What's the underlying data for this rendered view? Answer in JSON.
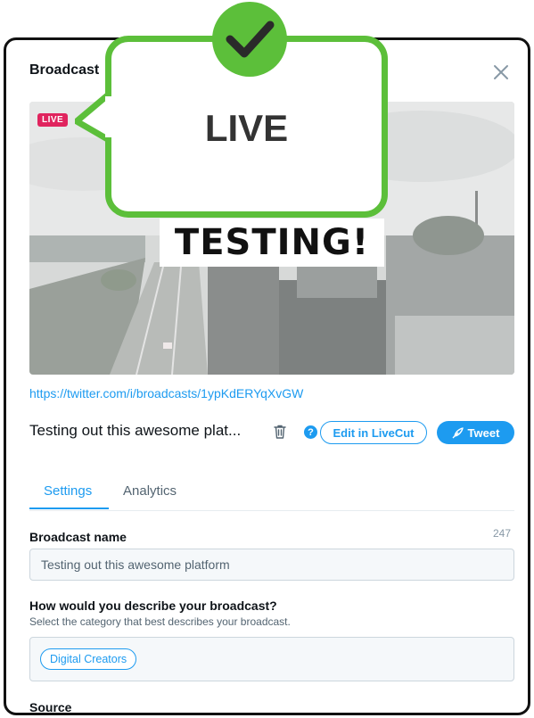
{
  "header": {
    "title": "Broadcast"
  },
  "video": {
    "live_badge": "LIVE",
    "banner_text": "TESTING!"
  },
  "broadcast": {
    "link": "https://twitter.com/i/broadcasts/1ypKdERYqXvGW",
    "title": "Testing out this awesome plat...",
    "help_glyph": "?",
    "edit_label": "Edit in LiveCut",
    "tweet_label": "Tweet"
  },
  "tabs": [
    {
      "label": "Settings",
      "active": true
    },
    {
      "label": "Analytics",
      "active": false
    }
  ],
  "settings": {
    "name_label": "Broadcast name",
    "name_counter": "247",
    "name_value": "Testing out this awesome platform",
    "describe_label": "How would you describe your broadcast?",
    "describe_sub": "Select the category that best describes your broadcast.",
    "category": "Digital Creators",
    "source_label": "Source"
  },
  "overlay": {
    "callout_text": "LIVE"
  },
  "colors": {
    "accent": "#1d9bf0",
    "live": "#e0245e",
    "callout_green": "#5cbf3a"
  },
  "icons": [
    "close-icon",
    "trash-icon",
    "help-icon",
    "tweet-feather-icon",
    "checkmark-icon"
  ]
}
